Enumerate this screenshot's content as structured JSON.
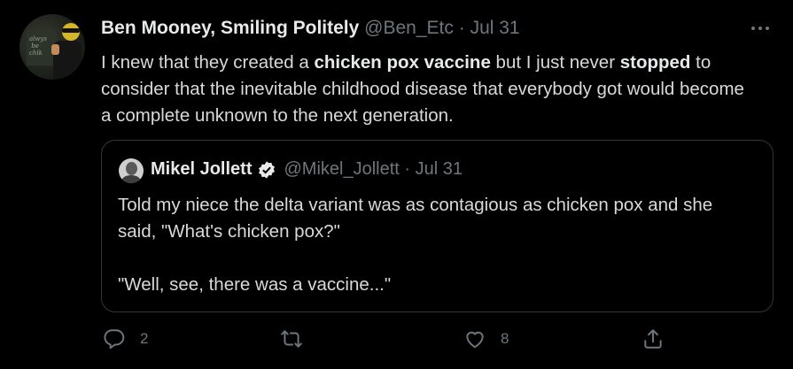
{
  "tweet": {
    "author": {
      "name": "Ben Mooney, Smiling Politely",
      "handle": "@Ben_Etc",
      "date": "Jul 31",
      "avatar_icon": "profile-avatar"
    },
    "text": [
      {
        "t": "I knew that they created a ",
        "bold": false
      },
      {
        "t": "chicken pox vaccine",
        "bold": true
      },
      {
        "t": " but I just never ",
        "bold": false
      },
      {
        "t": "stopped",
        "bold": true
      },
      {
        "t": " to consider that the inevitable childhood disease that everybody got would become a complete unknown to the next generation.",
        "bold": false
      }
    ],
    "avatar_text": "always be chalk"
  },
  "quote": {
    "author": {
      "name": "Mikel Jollett",
      "handle": "@Mikel_Jollett",
      "date": "Jul 31",
      "verified_icon": "verified-badge-icon"
    },
    "paragraphs": [
      "Told my niece the delta variant was as contagious as chicken pox and she said, \"What's chicken pox?\"",
      "",
      "\"Well, see, there was a vaccine...\""
    ]
  },
  "actions": {
    "reply_count": "2",
    "retweet_count": "",
    "like_count": "8",
    "icons": [
      "reply-icon",
      "retweet-icon",
      "like-icon",
      "share-icon"
    ]
  },
  "colors": {
    "background": "#000000",
    "text": "#d9d9d9",
    "muted": "#6e767d",
    "border": "#333639"
  }
}
